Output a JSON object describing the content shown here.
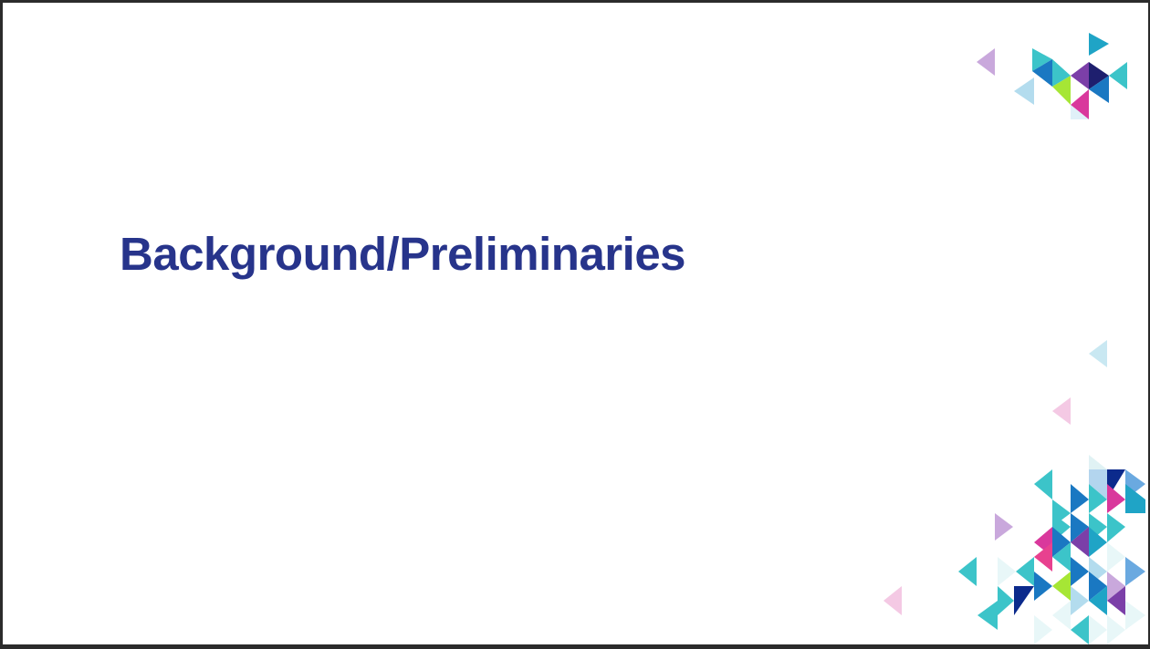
{
  "slide": {
    "title": "Background/Preliminaries",
    "colors": {
      "title": "#27348b",
      "background": "#ffffff",
      "frame": "#2b2b2b"
    },
    "decoration": {
      "name": "triangle-mosaic",
      "palette": [
        "#c9a8dc",
        "#3cc4c9",
        "#1a78c2",
        "#0b2a8c",
        "#7b3fa8",
        "#a6e635",
        "#d9389c",
        "#b3dcee",
        "#e8f7f8",
        "#f4c9e4"
      ]
    }
  }
}
